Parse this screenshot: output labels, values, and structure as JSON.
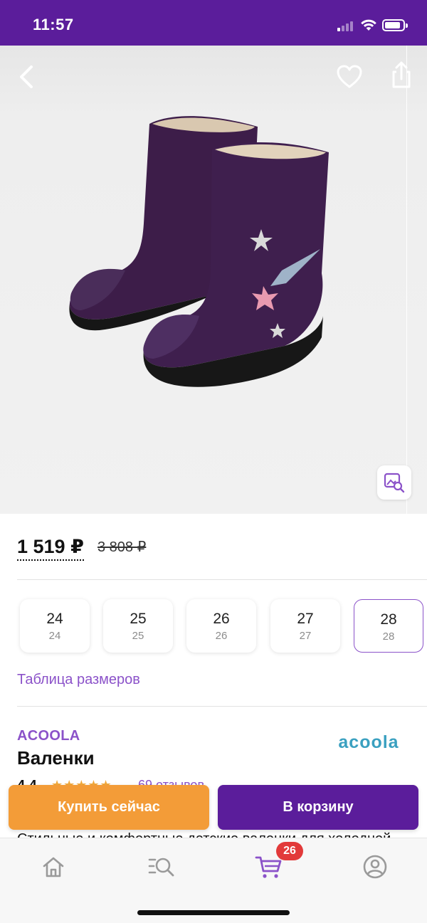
{
  "status_bar": {
    "time": "11:57"
  },
  "product": {
    "price": "1 519 ₽",
    "old_price": "3 808 ₽",
    "brand": "ACOOLA",
    "brand_logo_text": "acoola",
    "title": "Валенки",
    "rating": "4.4",
    "stars": "★★★★★",
    "reviews": "69 отзывов",
    "description_peek": "Стильные и комфортные детские валенки для холодной"
  },
  "sizes": [
    {
      "main": "24",
      "sub": "24",
      "selected": false
    },
    {
      "main": "25",
      "sub": "25",
      "selected": false
    },
    {
      "main": "26",
      "sub": "26",
      "selected": false
    },
    {
      "main": "27",
      "sub": "27",
      "selected": false
    },
    {
      "main": "28",
      "sub": "28",
      "selected": true
    }
  ],
  "size_table_link": "Таблица размеров",
  "actions": {
    "buy_now": "Купить сейчас",
    "add_to_cart": "В корзину"
  },
  "tab_bar": {
    "items": [
      {
        "icon": "home-icon"
      },
      {
        "icon": "catalog-search-icon"
      },
      {
        "icon": "cart-icon"
      },
      {
        "icon": "profile-icon"
      }
    ],
    "cart_badge": "26",
    "active_index": 2
  },
  "colors": {
    "brand_purple": "#5b1d9b",
    "accent_purple": "#8b52c9",
    "orange": "#f39c38",
    "badge_red": "#e23a3a"
  }
}
